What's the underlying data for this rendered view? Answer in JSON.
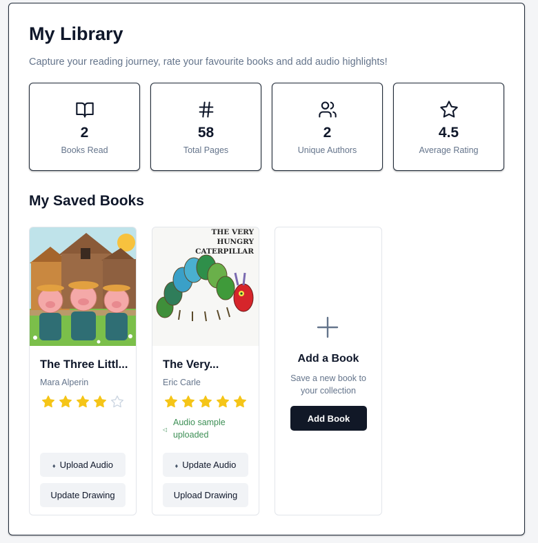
{
  "header": {
    "title": "My Library",
    "subtitle": "Capture your reading journey, rate your favourite books and add audio highlights!"
  },
  "stats": [
    {
      "icon": "open-book-icon",
      "value": "2",
      "label": "Books Read"
    },
    {
      "icon": "hash-icon",
      "value": "58",
      "label": "Total Pages"
    },
    {
      "icon": "users-icon",
      "value": "2",
      "label": "Unique Authors"
    },
    {
      "icon": "star-icon",
      "value": "4.5",
      "label": "Average Rating"
    }
  ],
  "saved": {
    "title": "My Saved Books",
    "books": [
      {
        "title": "The Three Littl...",
        "author": "Mara Alperin",
        "rating": 4,
        "rating_max": 5,
        "cover_icon": "three-little-pigs-illustration",
        "audio_button": "Upload Audio",
        "drawing_button": "Update Drawing"
      },
      {
        "title": "The Very...",
        "author": "Eric Carle",
        "rating": 5,
        "rating_max": 5,
        "cover_icon": "hungry-caterpillar-illustration",
        "cover_text": [
          "THE VERY",
          "HUNGRY",
          "CATERPILLAR"
        ],
        "audio_status": "Audio sample uploaded",
        "audio_button": "Update Audio",
        "drawing_button": "Upload Drawing"
      }
    ],
    "add_card": {
      "icon": "plus-icon",
      "title": "Add a Book",
      "description": "Save a new book to your collection",
      "button": "Add Book"
    }
  },
  "colors": {
    "star_filled": "#f5c518",
    "star_empty": "#cbd5e1",
    "primary_button": "#111827",
    "success_text": "#3d8f55",
    "muted_text": "#64748b"
  }
}
